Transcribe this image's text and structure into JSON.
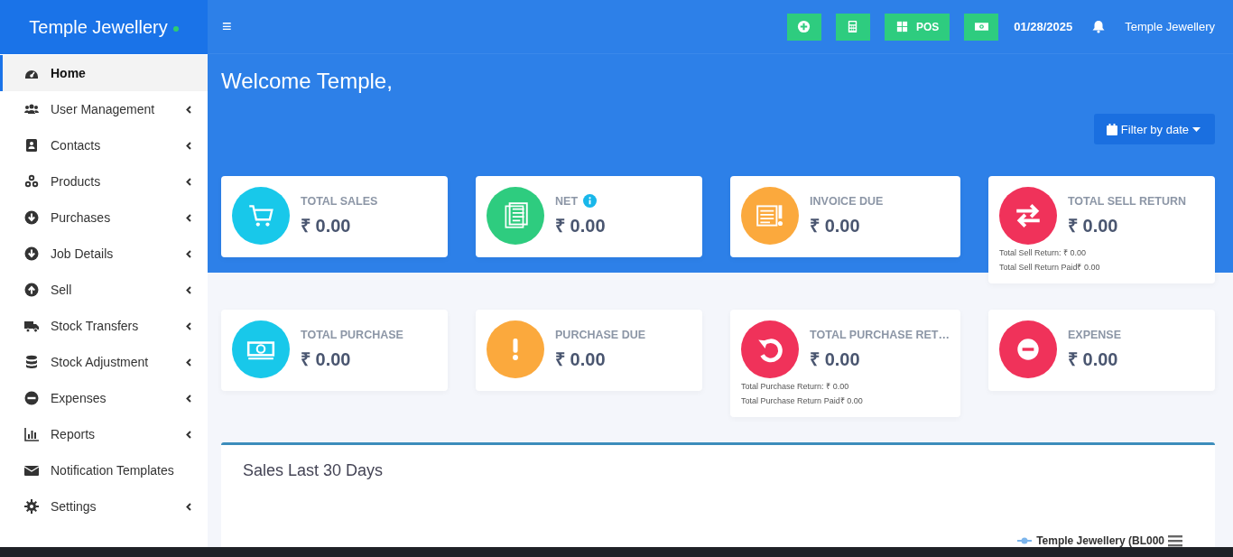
{
  "brand": {
    "name": "Temple Jewellery",
    "online": true
  },
  "sidebar": {
    "items": [
      {
        "label": "Home",
        "kind": "dashboard",
        "selected": true,
        "submenu": false
      },
      {
        "label": "User Management",
        "kind": "users",
        "selected": false,
        "submenu": true
      },
      {
        "label": "Contacts",
        "kind": "contact",
        "selected": false,
        "submenu": true
      },
      {
        "label": "Products",
        "kind": "cubes",
        "selected": false,
        "submenu": true
      },
      {
        "label": "Purchases",
        "kind": "down",
        "selected": false,
        "submenu": true
      },
      {
        "label": "Job Details",
        "kind": "down",
        "selected": false,
        "submenu": true
      },
      {
        "label": "Sell",
        "kind": "up",
        "selected": false,
        "submenu": true
      },
      {
        "label": "Stock Transfers",
        "kind": "truck",
        "selected": false,
        "submenu": true
      },
      {
        "label": "Stock Adjustment",
        "kind": "database",
        "selected": false,
        "submenu": true
      },
      {
        "label": "Expenses",
        "kind": "minus",
        "selected": false,
        "submenu": true
      },
      {
        "label": "Reports",
        "kind": "chart",
        "selected": false,
        "submenu": true
      },
      {
        "label": "Notification Templates",
        "kind": "envelope",
        "selected": false,
        "submenu": false
      },
      {
        "label": "Settings",
        "kind": "gear",
        "selected": false,
        "submenu": true
      }
    ]
  },
  "topbar": {
    "menu_glyph": "≡",
    "buttons": [
      {
        "kind": "add"
      },
      {
        "kind": "calculator"
      },
      {
        "kind": "pos",
        "label": "POS"
      },
      {
        "kind": "cash"
      }
    ],
    "date": "01/28/2025",
    "user": "Temple Jewellery"
  },
  "welcome": "Welcome Temple,",
  "filter_button": "Filter by date",
  "stats": [
    {
      "title": "TOTAL SALES",
      "value": "₹ 0.00",
      "kind": "cart",
      "color": "#18c8ea",
      "info": false
    },
    {
      "title": "NET",
      "value": "₹ 0.00",
      "kind": "document",
      "color": "#2ecc7f",
      "info": true
    },
    {
      "title": "INVOICE DUE",
      "value": "₹ 0.00",
      "kind": "invoice",
      "color": "#fba93d",
      "info": false
    },
    {
      "title": "TOTAL SELL RETURN",
      "value": "₹ 0.00",
      "kind": "exchange",
      "color": "#f0325a",
      "info": false,
      "details": [
        "Total Sell Return: ₹ 0.00",
        "Total Sell Return Paid₹ 0.00"
      ]
    },
    {
      "title": "TOTAL PURCHASE",
      "value": "₹ 0.00",
      "kind": "money",
      "color": "#18c8ea",
      "info": false
    },
    {
      "title": "PURCHASE DUE",
      "value": "₹ 0.00",
      "kind": "exclamation",
      "color": "#fba93d",
      "info": false
    },
    {
      "title": "TOTAL PURCHASE RET…",
      "value": "₹ 0.00",
      "kind": "undo",
      "color": "#f0325a",
      "info": false,
      "details": [
        "Total Purchase Return: ₹ 0.00",
        "Total Purchase Return Paid₹ 0.00"
      ]
    },
    {
      "title": "EXPENSE",
      "value": "₹ 0.00",
      "kind": "minus-circle",
      "color": "#f0325a",
      "info": false
    }
  ],
  "sales_panel": {
    "title": "Sales Last 30 Days",
    "legend": "Temple Jewellery (BL000"
  }
}
